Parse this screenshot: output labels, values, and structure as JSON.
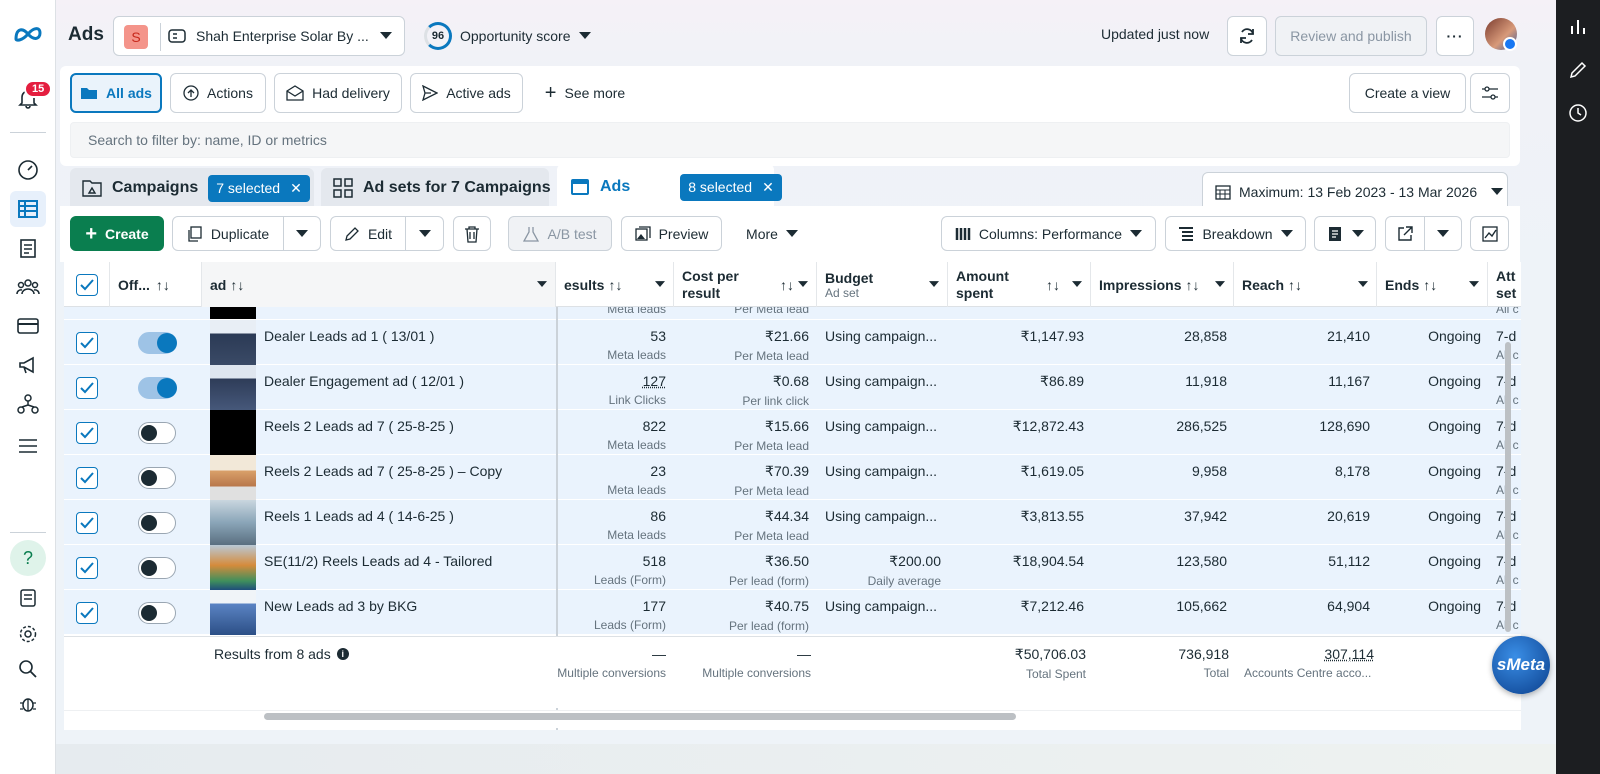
{
  "app": {
    "title": "Ads",
    "account_name": "Shah Enterprise Solar By ...",
    "account_initial": "S",
    "opportunity_score": "96",
    "opportunity_label": "Opportunity score",
    "updated": "Updated just now",
    "review_publish": "Review and publish"
  },
  "nav": {
    "notifications": "15"
  },
  "filters": {
    "all_ads": "All ads",
    "actions": "Actions",
    "had_delivery": "Had delivery",
    "active_ads": "Active ads",
    "see_more": "See more",
    "create_view": "Create a view",
    "search_placeholder": "Search to filter by: name, ID or metrics"
  },
  "tabs": {
    "campaigns": {
      "label": "Campaigns",
      "selected": "7 selected"
    },
    "adsets": {
      "label": "Ad sets for 7 Campaigns"
    },
    "ads": {
      "label": "Ads",
      "selected": "8 selected"
    },
    "date_range": "Maximum: 13 Feb 2023 - 13 Mar 2026"
  },
  "toolbar": {
    "create": "Create",
    "duplicate": "Duplicate",
    "edit": "Edit",
    "ab_test": "A/B test",
    "preview": "Preview",
    "more": "More",
    "columns": "Columns: Performance",
    "breakdown": "Breakdown"
  },
  "columns": {
    "off": "Off...",
    "ad": "ad",
    "results": "esults",
    "cost_per_result": "Cost per result",
    "budget": "Budget",
    "budget_sub": "Ad set",
    "amount_spent": "Amount spent",
    "impressions": "Impressions",
    "reach": "Reach",
    "ends": "Ends",
    "att": "Att set"
  },
  "top_partial": {
    "results_sub": "Meta leads",
    "cost_sub": "Per Meta lead",
    "att": "All c"
  },
  "rows": [
    {
      "name": "Dealer Leads ad 1 ( 13/01 )",
      "on": true,
      "results": "53",
      "results_sub": "Meta leads",
      "cost": "₹21.66",
      "cost_sub": "Per Meta lead",
      "budget": "Using campaign...",
      "budget_sub": "",
      "spent": "₹1,147.93",
      "impressions": "28,858",
      "reach": "21,410",
      "ends": "Ongoing",
      "att": "7-d",
      "att_sub": "All c"
    },
    {
      "name": "Dealer Engagement ad ( 12/01 )",
      "on": true,
      "results": "127",
      "results_sub": "Link Clicks",
      "cost": "₹0.68",
      "cost_sub": "Per link click",
      "budget": "Using campaign...",
      "budget_sub": "",
      "spent": "₹86.89",
      "impressions": "11,918",
      "reach": "11,167",
      "ends": "Ongoing",
      "att": "7-d",
      "att_sub": "All c"
    },
    {
      "name": "Reels 2 Leads ad 7 ( 25-8-25 )",
      "on": false,
      "results": "822",
      "results_sub": "Meta leads",
      "cost": "₹15.66",
      "cost_sub": "Per Meta lead",
      "budget": "Using campaign...",
      "budget_sub": "",
      "spent": "₹12,872.43",
      "impressions": "286,525",
      "reach": "128,690",
      "ends": "Ongoing",
      "att": "7-d",
      "att_sub": "All c"
    },
    {
      "name": "Reels 2 Leads ad 7 ( 25-8-25 ) – Copy",
      "on": false,
      "results": "23",
      "results_sub": "Meta leads",
      "cost": "₹70.39",
      "cost_sub": "Per Meta lead",
      "budget": "Using campaign...",
      "budget_sub": "",
      "spent": "₹1,619.05",
      "impressions": "9,958",
      "reach": "8,178",
      "ends": "Ongoing",
      "att": "7-d",
      "att_sub": "All c"
    },
    {
      "name": "Reels 1 Leads ad 4 ( 14-6-25 )",
      "on": false,
      "results": "86",
      "results_sub": "Meta leads",
      "cost": "₹44.34",
      "cost_sub": "Per Meta lead",
      "budget": "Using campaign...",
      "budget_sub": "",
      "spent": "₹3,813.55",
      "impressions": "37,942",
      "reach": "20,619",
      "ends": "Ongoing",
      "att": "7-d",
      "att_sub": "All c"
    },
    {
      "name": "SE(11/2) Reels Leads ad 4 - Tailored",
      "on": false,
      "results": "518",
      "results_sub": "Leads (Form)",
      "cost": "₹36.50",
      "cost_sub": "Per lead (form)",
      "budget": "₹200.00",
      "budget_sub": "Daily average",
      "spent": "₹18,904.54",
      "impressions": "123,580",
      "reach": "51,112",
      "ends": "Ongoing",
      "att": "7-d",
      "att_sub": "All c"
    },
    {
      "name": "New Leads ad 3 by BKG",
      "on": false,
      "results": "177",
      "results_sub": "Leads (Form)",
      "cost": "₹40.75",
      "cost_sub": "Per lead (form)",
      "budget": "Using campaign...",
      "budget_sub": "",
      "spent": "₹7,212.46",
      "impressions": "105,662",
      "reach": "64,904",
      "ends": "Ongoing",
      "att": "7-d",
      "att_sub": "All c"
    }
  ],
  "totals": {
    "label": "Results from 8 ads",
    "results": "—",
    "results_sub": "Multiple conversions",
    "cost": "—",
    "cost_sub": "Multiple conversions",
    "spent": "₹50,706.03",
    "spent_sub": "Total Spent",
    "impressions": "736,918",
    "impressions_sub": "Total",
    "reach": "307,114",
    "reach_sub": "Accounts Centre acco..."
  },
  "assistant_logo": "sMeta"
}
